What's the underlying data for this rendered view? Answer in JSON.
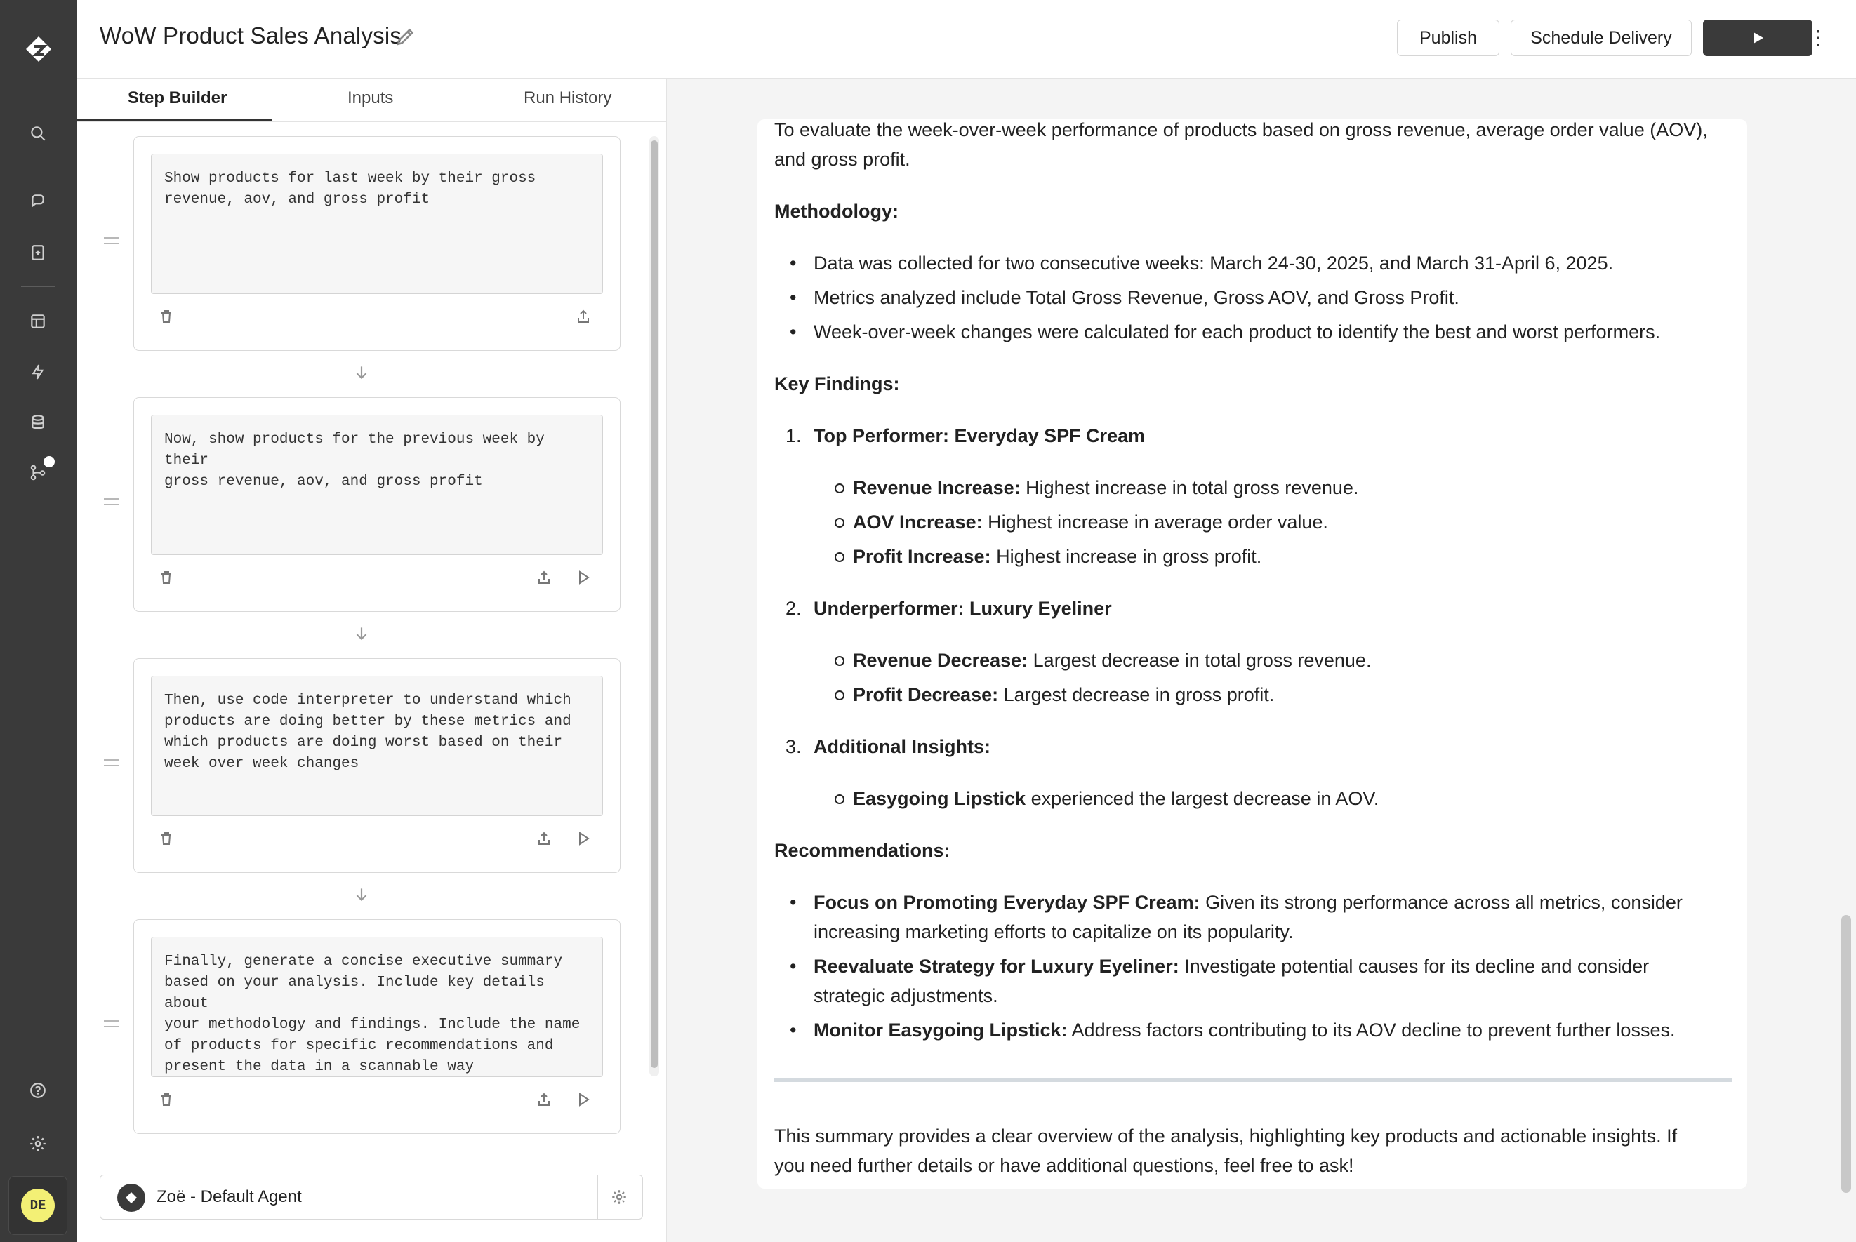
{
  "app": {
    "title": "WoW Product Sales Analysis",
    "user_initials": "DE",
    "accent": "#3a3a3a",
    "avatar_color": "#f3f075"
  },
  "nav_icons": [
    "logo-icon",
    "search-icon",
    "chat-icon",
    "bookmark-icon",
    "layout-icon",
    "bolt-icon",
    "database-icon",
    "git-branch-icon",
    "help-icon",
    "gear-icon"
  ],
  "toolbar": {
    "publish_label": "Publish",
    "schedule_label": "Schedule Delivery",
    "run_icon": "play-icon",
    "more_icon": "more-vertical-icon"
  },
  "tabs": [
    {
      "label": "Step Builder",
      "active": true
    },
    {
      "label": "Inputs",
      "active": false
    },
    {
      "label": "Run History",
      "active": false
    }
  ],
  "steps": [
    {
      "prompt": "Show products for last week by their gross\nrevenue, aov, and gross profit"
    },
    {
      "prompt": "Now, show products for the previous week by their\ngross revenue, aov, and gross profit"
    },
    {
      "prompt": "Then, use code interpreter to understand which\nproducts are doing better by these metrics and\nwhich products are doing worst based on their\nweek over week changes"
    },
    {
      "prompt": "Finally, generate a concise executive summary\nbased on your analysis. Include key details about\nyour methodology and findings. Include the name\nof products for specific recommendations and\npresent the data in a scannable way"
    }
  ],
  "agent": {
    "name": "Zoë - Default Agent"
  },
  "report": {
    "intro_line1": "To evaluate the week-over-week performance of products based on gross revenue, average order value (AOV),",
    "intro_line2": "and gross profit.",
    "methodology_heading": "Methodology:",
    "methodology": [
      "Data was collected for two consecutive weeks: March 24-30, 2025, and March 31-April 6, 2025.",
      "Metrics analyzed include Total Gross Revenue, Gross AOV, and Gross Profit.",
      "Week-over-week changes were calculated for each product to identify the best and worst performers."
    ],
    "findings_heading": "Key Findings:",
    "findings": [
      {
        "num": "1.",
        "title": "Top Performer: Everyday SPF Cream",
        "items": [
          {
            "label": "Revenue Increase:",
            "text": " Highest increase in total gross revenue."
          },
          {
            "label": "AOV Increase:",
            "text": " Highest increase in average order value."
          },
          {
            "label": "Profit Increase:",
            "text": " Highest increase in gross profit."
          }
        ]
      },
      {
        "num": "2.",
        "title": "Underperformer: Luxury Eyeliner",
        "items": [
          {
            "label": "Revenue Decrease:",
            "text": " Largest decrease in total gross revenue."
          },
          {
            "label": "Profit Decrease:",
            "text": " Largest decrease in gross profit."
          }
        ]
      },
      {
        "num": "3.",
        "title": "Additional Insights:",
        "items": [
          {
            "label": "Easygoing Lipstick",
            "text": " experienced the largest decrease in AOV."
          }
        ]
      }
    ],
    "recommendations_heading": "Recommendations:",
    "recommendations": [
      {
        "label": "Focus on Promoting Everyday SPF Cream:",
        "text1": " Given its strong performance across all metrics, consider",
        "text2": "increasing marketing efforts to capitalize on its popularity."
      },
      {
        "label": "Reevaluate Strategy for Luxury Eyeliner:",
        "text1": " Investigate potential causes for its decline and consider",
        "text2": "strategic adjustments."
      },
      {
        "label": "Monitor Easygoing Lipstick:",
        "text1": " Address factors contributing to its AOV decline to prevent further losses.",
        "text2": ""
      }
    ],
    "closing_line1": "This summary provides a clear overview of the analysis, highlighting key products and actionable insights. If",
    "closing_line2": "you need further details or have additional questions, feel free to ask!"
  }
}
